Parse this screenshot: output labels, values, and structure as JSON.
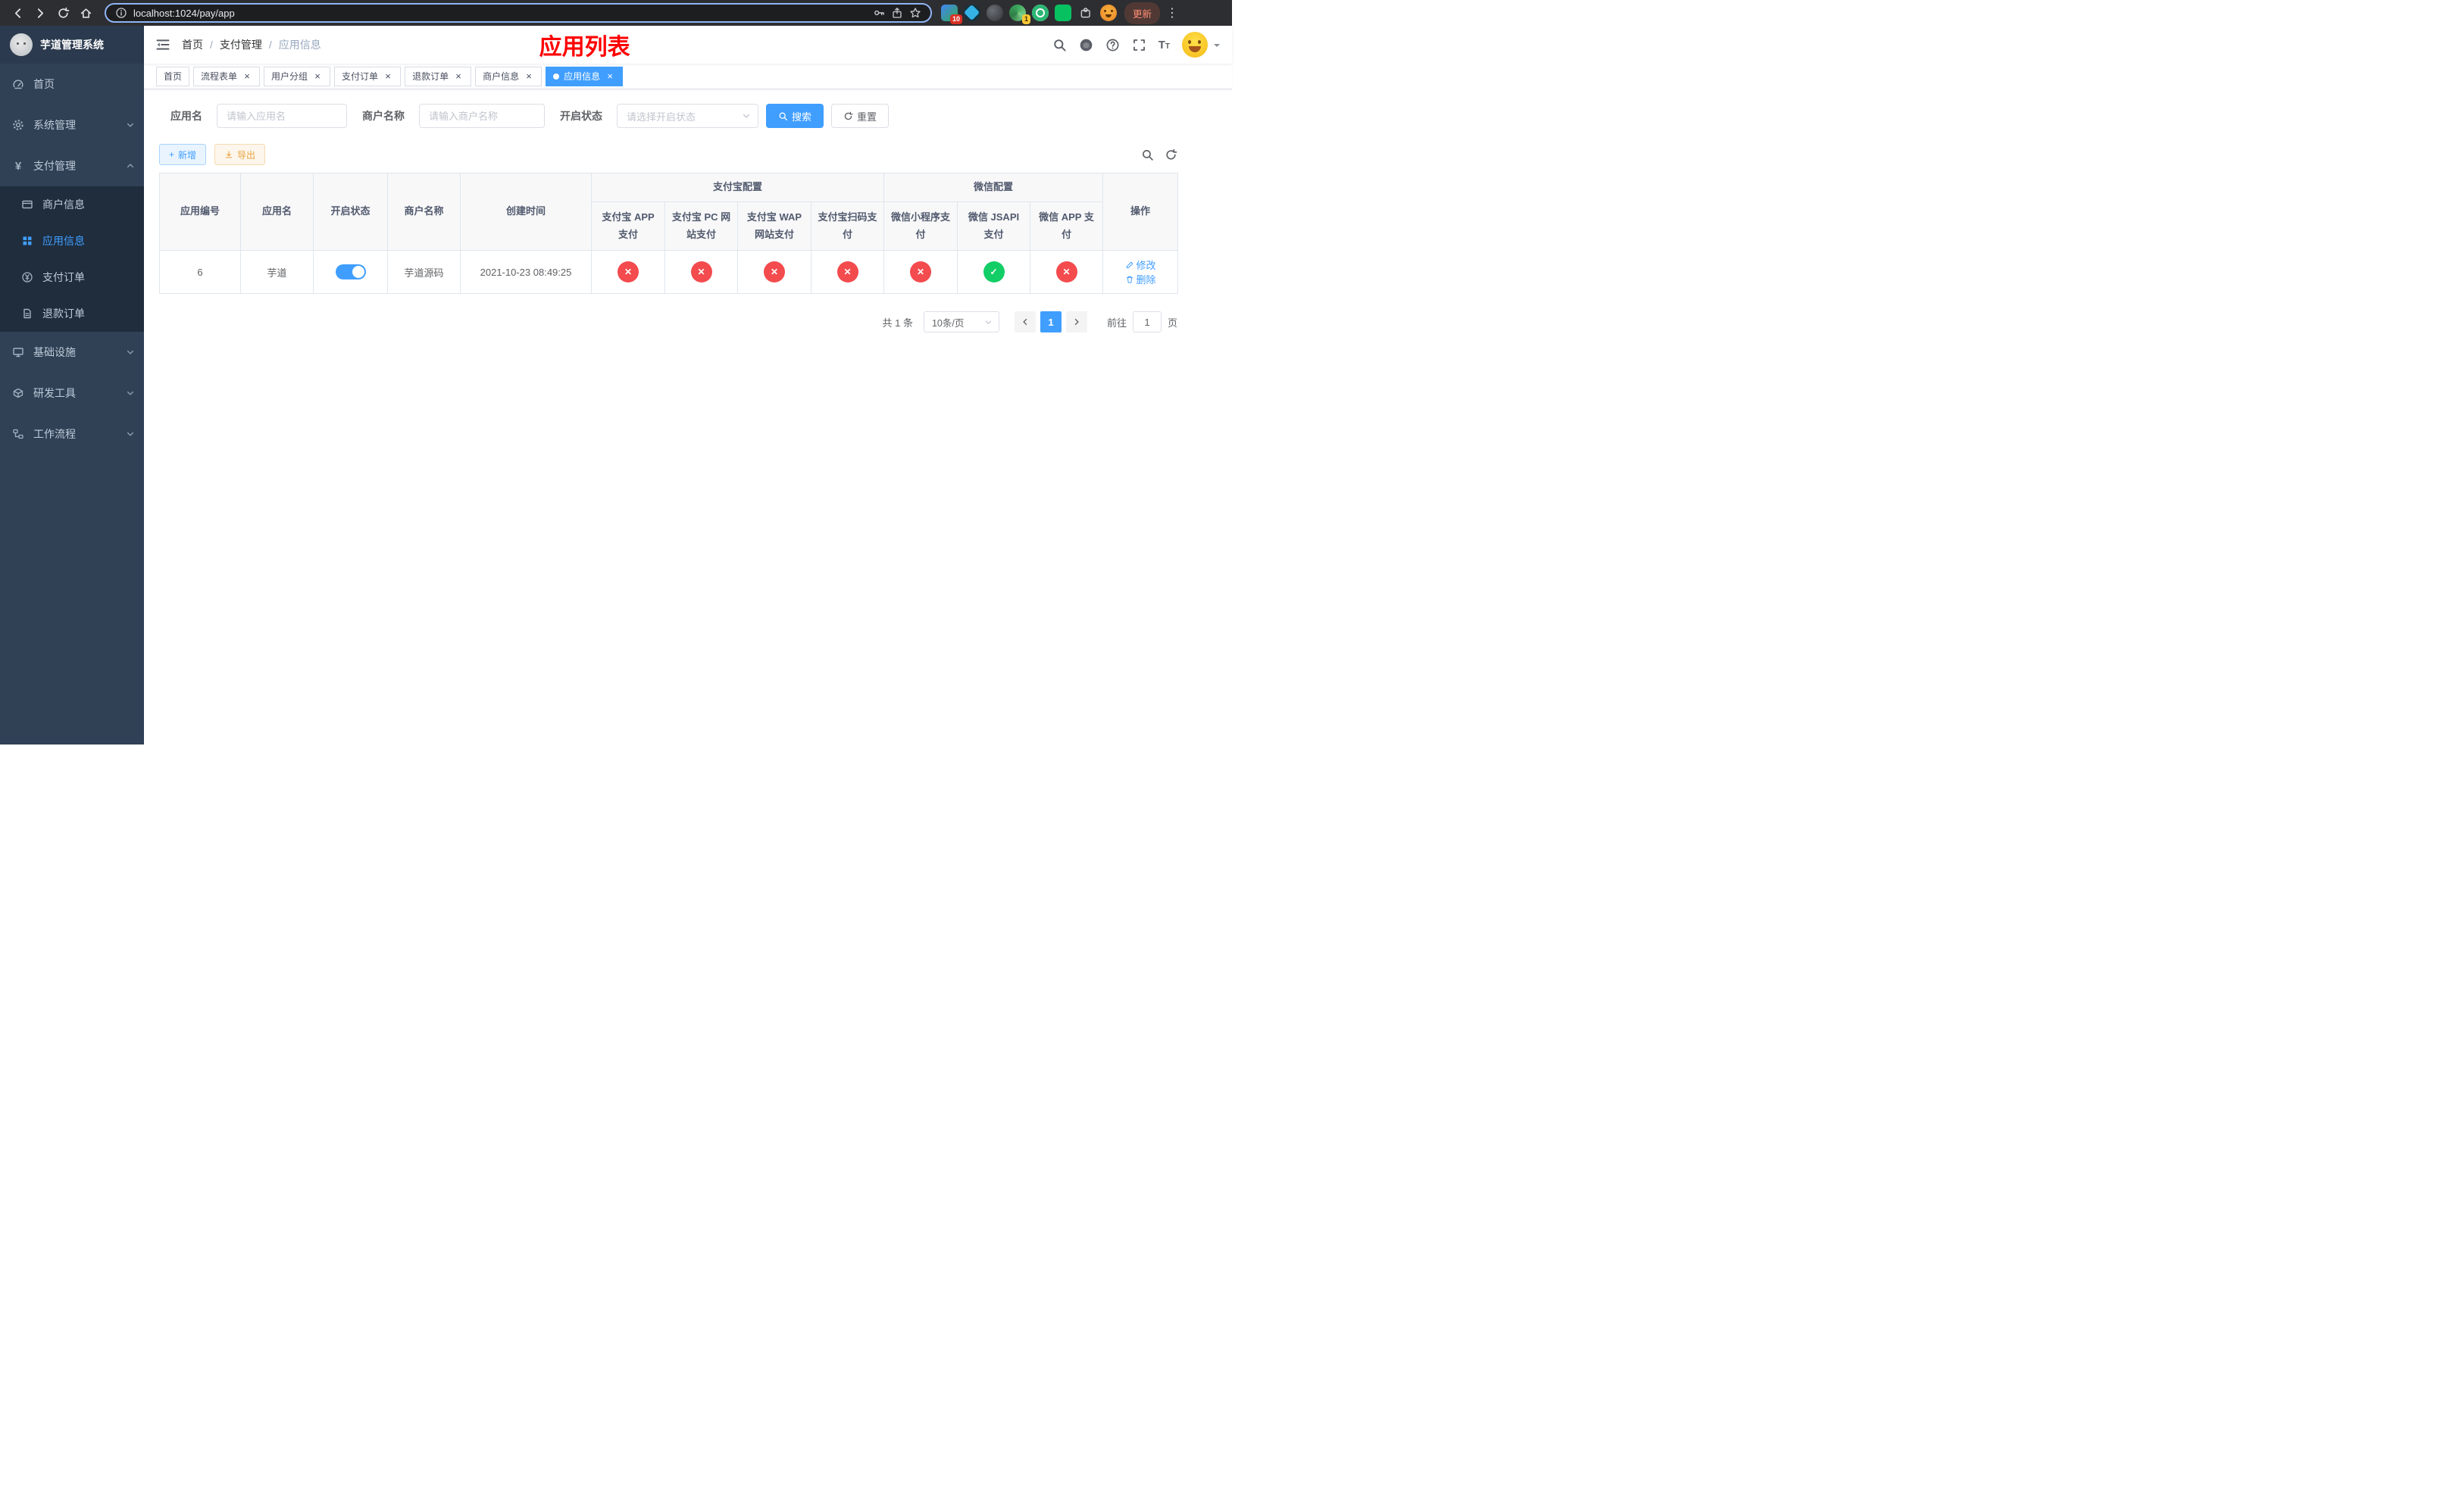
{
  "colors": {
    "primary": "#409eff",
    "danger": "#f34b4e",
    "success": "#13ce66",
    "title_red": "#ff0000",
    "sidebar_bg": "#304156",
    "submenu_bg": "#1f2d3d"
  },
  "glyphs": {
    "check": "✓",
    "cross": "✕",
    "close": "×",
    "plus": "+",
    "yen": "¥",
    "ellipsis": "⋮",
    "font_big": "T",
    "font_small": "T"
  },
  "browser": {
    "url": "localhost:1024/pay/app",
    "update_label": "更新",
    "ext_badge_count": "10",
    "profile_badge_count": "1"
  },
  "sidebar": {
    "logo_title": "芋道管理系统",
    "menu": {
      "home": "首页",
      "system": "系统管理",
      "payment": "支付管理",
      "infra": "基础设施",
      "devtools": "研发工具",
      "workflow": "工作流程"
    },
    "sub": {
      "merchant": "商户信息",
      "app": "应用信息",
      "pay_order": "支付订单",
      "refund_order": "退款订单"
    }
  },
  "header": {
    "breadcrumb": {
      "home": "首页",
      "section": "支付管理",
      "current": "应用信息"
    },
    "title": "应用列表"
  },
  "tabs": [
    {
      "label": "首页",
      "closable": false,
      "active": false
    },
    {
      "label": "流程表单",
      "closable": true,
      "active": false
    },
    {
      "label": "用户分组",
      "closable": true,
      "active": false
    },
    {
      "label": "支付订单",
      "closable": true,
      "active": false
    },
    {
      "label": "退款订单",
      "closable": true,
      "active": false
    },
    {
      "label": "商户信息",
      "closable": true,
      "active": false
    },
    {
      "label": "应用信息",
      "closable": true,
      "active": true
    }
  ],
  "filters": {
    "app_name_label": "应用名",
    "app_name_placeholder": "请输入应用名",
    "merchant_label": "商户名称",
    "merchant_placeholder": "请输入商户名称",
    "status_label": "开启状态",
    "status_placeholder": "请选择开启状态",
    "search_label": "搜索",
    "reset_label": "重置"
  },
  "toolbar": {
    "add_label": "新增",
    "export_label": "导出"
  },
  "table": {
    "col_app_id": "应用编号",
    "col_app_name": "应用名",
    "col_status": "开启状态",
    "col_merchant": "商户名称",
    "col_created": "创建时间",
    "group_alipay": "支付宝配置",
    "group_wechat": "微信配置",
    "col_alipay_app": "支付宝 APP 支付",
    "col_alipay_pc": "支付宝 PC 网站支付",
    "col_alipay_wap": "支付宝 WAP 网站支付",
    "col_alipay_qr": "支付宝扫码支付",
    "col_wx_mini": "微信小程序支付",
    "col_wx_jsapi": "微信 JSAPI 支付",
    "col_wx_app": "微信 APP 支付",
    "col_actions": "操作",
    "row": {
      "id": "6",
      "name": "芋道",
      "enabled": true,
      "merchant": "芋道源码",
      "created": "2021-10-23 08:49:25",
      "alipay_app": false,
      "alipay_pc": false,
      "alipay_wap": false,
      "alipay_qr": false,
      "wx_mini": false,
      "wx_jsapi": true,
      "wx_app": false,
      "edit_label": "修改",
      "delete_label": "删除"
    }
  },
  "pagination": {
    "total": "共 1 条",
    "page_size": "10条/页",
    "page": "1",
    "goto_label": "前往",
    "goto_value": "1",
    "goto_unit": "页"
  }
}
